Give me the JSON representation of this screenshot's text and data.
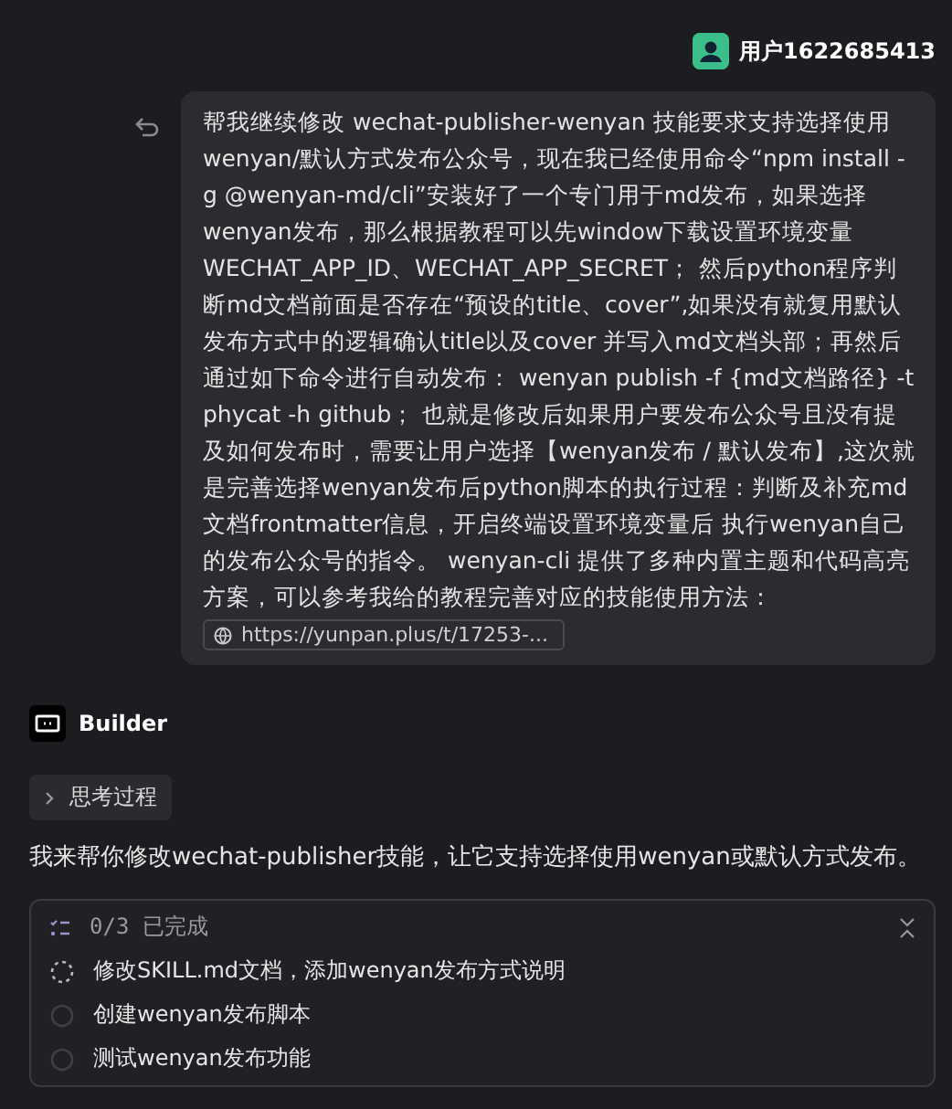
{
  "user": {
    "name": "用户1622685413"
  },
  "message": {
    "text": "帮我继续修改 wechat-publisher-wenyan 技能要求支持选择使用wenyan/默认方式发布公众号，现在我已经使用命令“npm install -g @wenyan-md/cli”安装好了一个专门用于md发布，如果选择wenyan发布，那么根据教程可以先window下载设置环境变量WECHAT_APP_ID、WECHAT_APP_SECRET； 然后python程序判断md文档前面是否存在“预设的title、cover”,如果没有就复用默认发布方式中的逻辑确认title以及cover 并写入md文档头部；再然后通过如下命令进行自动发布： wenyan publish -f  {md文档路径}  -t phycat -h github； 也就是修改后如果用户要发布公众号且没有提及如何发布时，需要让用户选择【wenyan发布 / 默认发布】,这次就是完善选择wenyan发布后python脚本的执行过程：判断及补充md文档frontmatter信息，开启终端设置环境变量后 执行wenyan自己的发布公众号的指令。 wenyan-cli 提供了多种内置主题和代码高亮方案，可以参考我给的教程完善对应的技能使用方法：",
    "link": "https://yunpan.plus/t/17253-..."
  },
  "assistant": {
    "name": "Builder"
  },
  "thinking": {
    "label": "思考过程",
    "expanded": false
  },
  "reply": "我来帮你修改wechat-publisher技能，让它支持选择使用wenyan或默认方式发布。",
  "tasks": {
    "summary": "0/3 已完成",
    "items": [
      {
        "label": "修改SKILL.md文档，添加wenyan发布方式说明",
        "kind": "active"
      },
      {
        "label": "创建wenyan发布脚本",
        "kind": "pending"
      },
      {
        "label": "测试wenyan发布功能",
        "kind": "pending"
      }
    ]
  }
}
